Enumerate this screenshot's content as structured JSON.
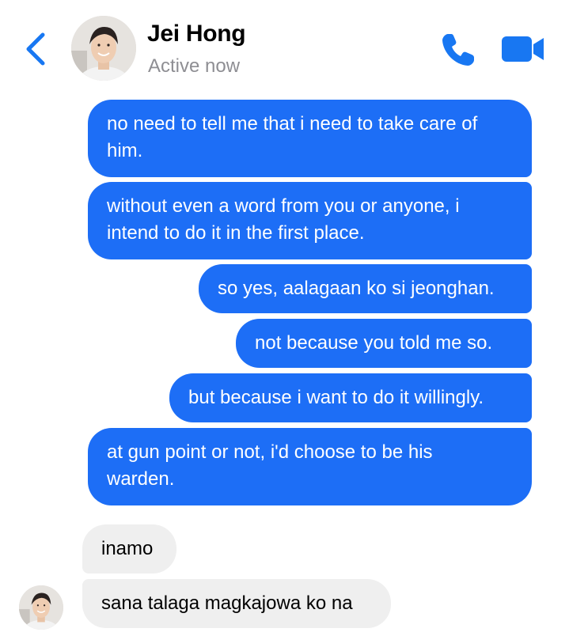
{
  "header": {
    "contact_name": "Jei Hong",
    "status": "Active now",
    "back_icon": "chevron-left-icon",
    "call_icon": "phone-icon",
    "video_icon": "video-camera-icon",
    "accent_color": "#1877f2"
  },
  "messages": {
    "outgoing": [
      {
        "line1": "no need to tell me that i need to take care of",
        "line2": "him."
      },
      {
        "line1": "without even a word from you or anyone, i",
        "line2": "intend to do it in the first place."
      },
      {
        "text": "so yes, aalagaan ko si jeonghan."
      },
      {
        "text": "not because you told me so."
      },
      {
        "text": "but because i want to do it willingly."
      },
      {
        "line1": "at gun point or not, i'd choose to be his",
        "line2": "warden."
      }
    ],
    "incoming": [
      {
        "text": "inamo"
      },
      {
        "text": "sana talaga magkajowa ko na"
      }
    ]
  },
  "colors": {
    "outgoing_bubble": "#1d6ef6",
    "incoming_bubble": "#efefef"
  }
}
